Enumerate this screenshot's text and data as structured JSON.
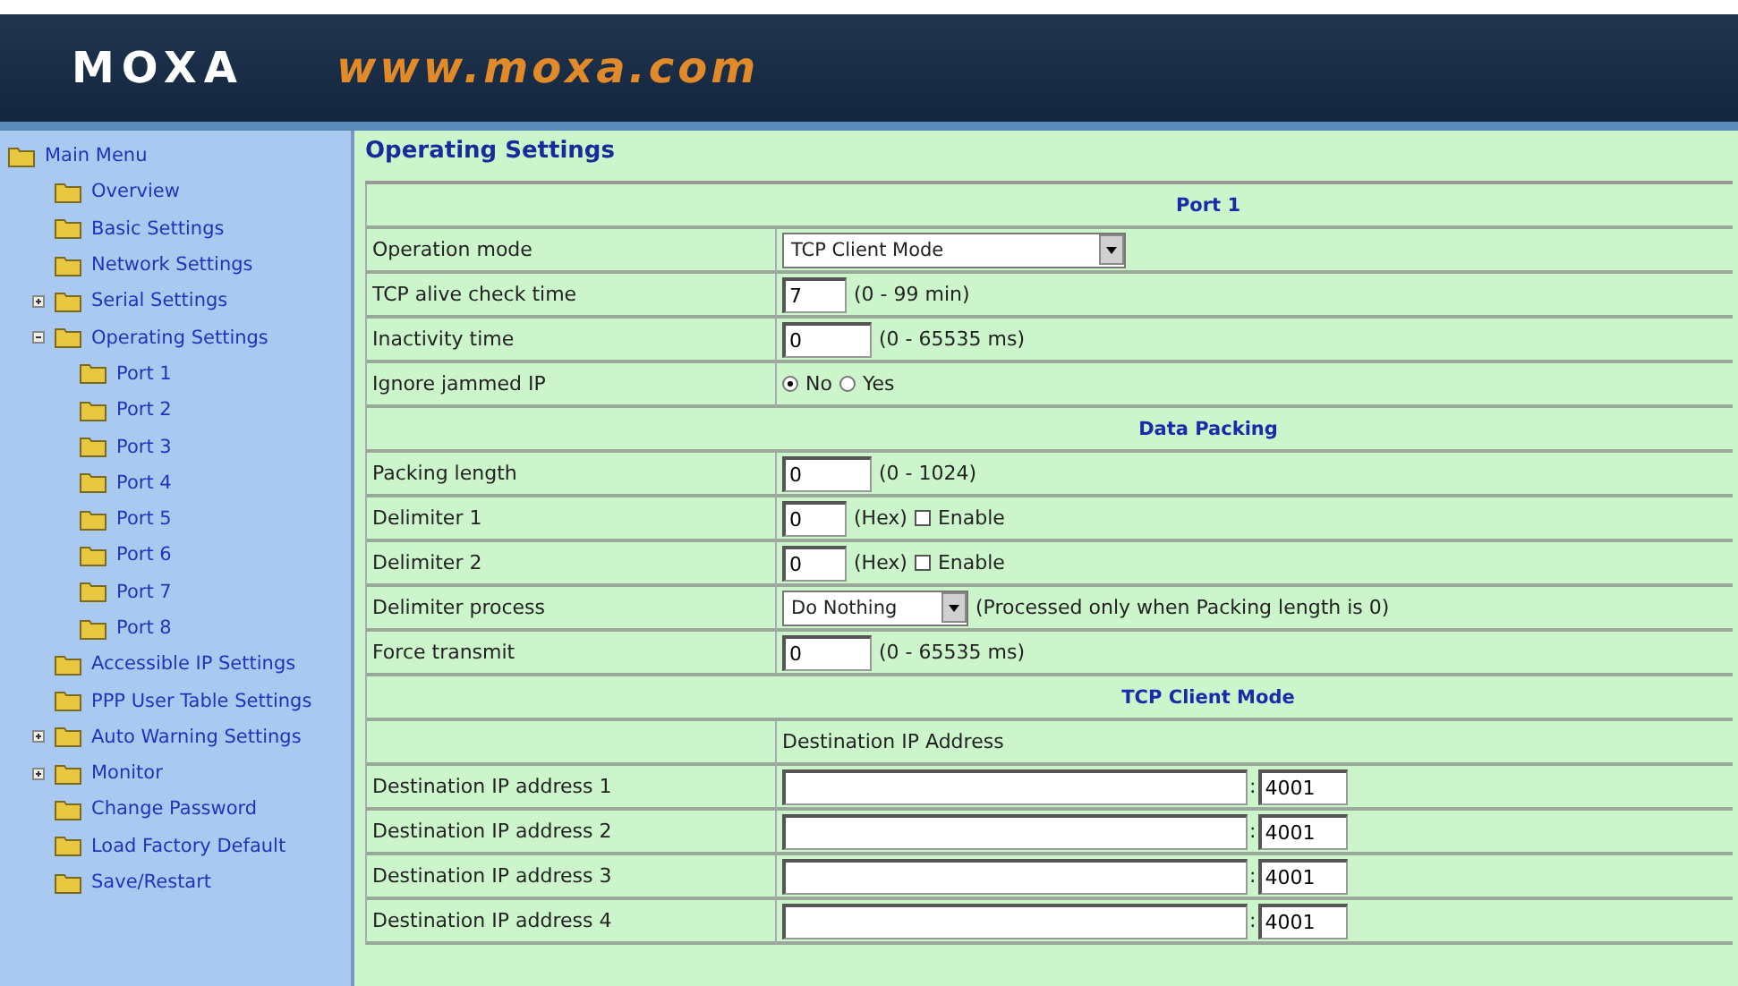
{
  "header": {
    "logo": "MOXA",
    "url": "www.moxa.com"
  },
  "sidebar": {
    "root": "Main Menu",
    "items": [
      {
        "label": "Overview"
      },
      {
        "label": "Basic Settings"
      },
      {
        "label": "Network Settings"
      },
      {
        "label": "Serial Settings",
        "expanded": false
      },
      {
        "label": "Operating Settings",
        "expanded": true,
        "children": [
          {
            "label": "Port 1"
          },
          {
            "label": "Port 2"
          },
          {
            "label": "Port 3"
          },
          {
            "label": "Port 4"
          },
          {
            "label": "Port 5"
          },
          {
            "label": "Port 6"
          },
          {
            "label": "Port 7"
          },
          {
            "label": "Port 8"
          }
        ]
      },
      {
        "label": "Accessible IP Settings"
      },
      {
        "label": "PPP User Table Settings"
      },
      {
        "label": "Auto Warning Settings",
        "expanded": false
      },
      {
        "label": "Monitor",
        "expanded": false
      },
      {
        "label": "Change Password"
      },
      {
        "label": "Load Factory Default"
      },
      {
        "label": "Save/Restart"
      }
    ]
  },
  "page_title": "Operating Settings",
  "rows": [
    {
      "kind": "section",
      "title": "Port 1"
    },
    {
      "kind": "select",
      "label": "Operation mode",
      "value": "TCP Client Mode"
    },
    {
      "kind": "number",
      "label": "TCP alive check time",
      "value": "7",
      "hint": "(0 - 99 min)"
    },
    {
      "kind": "number",
      "label": "Inactivity time",
      "value": "0",
      "hint": "(0 - 65535 ms)"
    },
    {
      "kind": "radio",
      "label": "Ignore jammed IP",
      "options": [
        {
          "label": "No",
          "selected": true
        },
        {
          "label": "Yes",
          "selected": false
        }
      ]
    },
    {
      "kind": "section",
      "title": "Data Packing"
    },
    {
      "kind": "number",
      "label": "Packing length",
      "value": "0",
      "hint": "(0 - 1024)"
    },
    {
      "kind": "hex",
      "label": "Delimiter 1",
      "value": "0",
      "hint": "(Hex)",
      "option": {
        "label": "Enable",
        "checked": false
      }
    },
    {
      "kind": "hex",
      "label": "Delimiter 2",
      "value": "0",
      "hint": "(Hex)",
      "option": {
        "label": "Enable",
        "checked": false
      }
    },
    {
      "kind": "select",
      "label": "Delimiter process",
      "value": "Do Nothing",
      "hint": "(Processed only when Packing length is 0)"
    },
    {
      "kind": "number",
      "label": "Force transmit",
      "value": "0",
      "hint": "(0 - 65535 ms)"
    },
    {
      "kind": "section",
      "title": "TCP Client Mode"
    },
    {
      "kind": "subheader",
      "title": "Destination IP Address"
    },
    {
      "kind": "ip",
      "label": "Destination IP address 1",
      "separator": ":",
      "port": "4001"
    },
    {
      "kind": "ip",
      "label": "Destination IP address 2",
      "separator": ":",
      "port": "4001"
    },
    {
      "kind": "ip",
      "label": "Destination IP address 3",
      "separator": ":",
      "port": "4001"
    },
    {
      "kind": "ip",
      "label": "Destination IP address 4",
      "separator": ":",
      "port": "4001"
    }
  ]
}
